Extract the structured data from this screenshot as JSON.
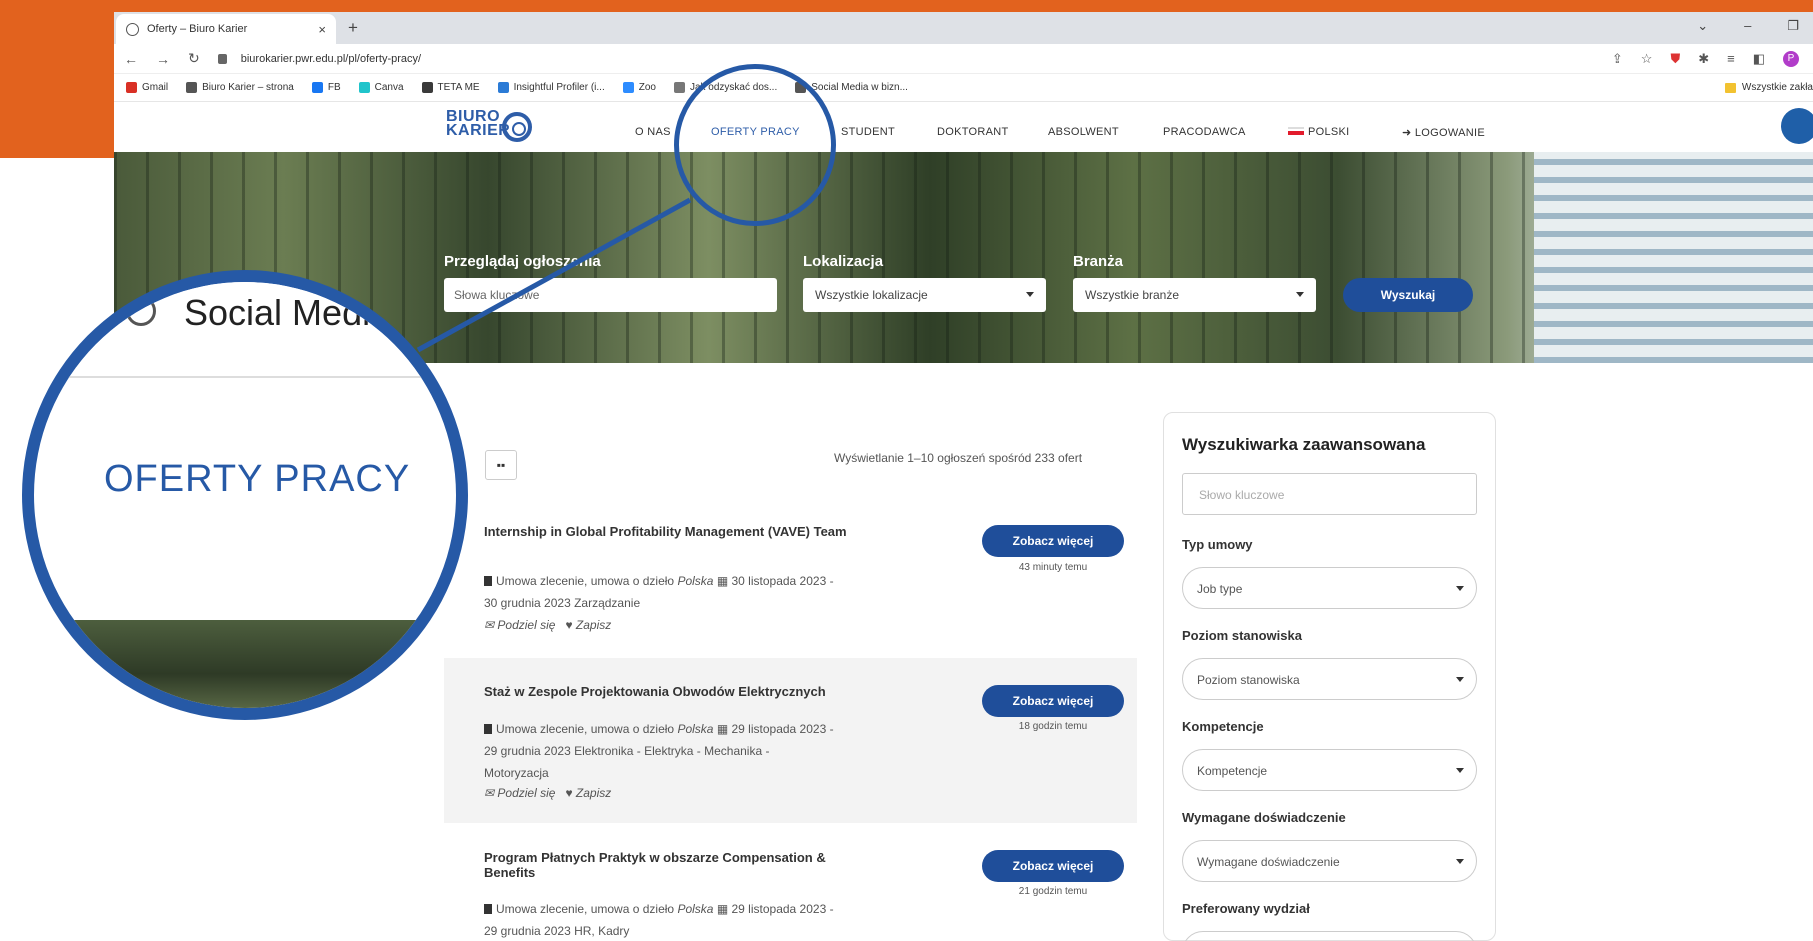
{
  "browser": {
    "tab_title": "Oferty – Biuro Karier",
    "tab_close": "×",
    "new_tab": "+",
    "url": "biurokarier.pwr.edu.pl/pl/oferty-pracy/",
    "bookmarks": [
      {
        "label": "Gmail",
        "icon_color": "#d93025"
      },
      {
        "label": "Biuro Karier – strona",
        "icon_color": "#555555"
      },
      {
        "label": "FB",
        "icon_color": "#1877f2"
      },
      {
        "label": "Canva",
        "icon_color": "#20c4cb"
      },
      {
        "label": "TETA ME",
        "icon_color": "#3a3a3a"
      },
      {
        "label": "Insightful Profiler (i...",
        "icon_color": "#2b7bd6"
      },
      {
        "label": "Zoo",
        "icon_color": "#2d8cff"
      },
      {
        "label": "Jak odzyskać dos...",
        "icon_color": "#777777"
      },
      {
        "label": "Social Media w bizn...",
        "icon_color": "#555555"
      }
    ],
    "bookmarks_other": "Wszystkie zakła"
  },
  "site": {
    "logo_line1": "BIURO",
    "logo_line2": "KARIER",
    "nav": [
      {
        "label": "O NAS",
        "active": false
      },
      {
        "label": "OFERTY PRACY",
        "active": true
      },
      {
        "label": "STUDENT",
        "active": false
      },
      {
        "label": "DOKTORANT",
        "active": false
      },
      {
        "label": "ABSOLWENT",
        "active": false
      },
      {
        "label": "PRACODAWCA",
        "active": false
      },
      {
        "label": "POLSKI",
        "active": false
      },
      {
        "label": "LOGOWANIE",
        "active": false
      }
    ]
  },
  "hero": {
    "browse_label": "Przeglądaj ogłoszenia",
    "keywords_placeholder": "Słowa kluczowe",
    "location_label": "Lokalizacja",
    "location_value": "Wszystkie lokalizacje",
    "industry_label": "Branża",
    "industry_value": "Wszystkie branże",
    "search_button": "Wyszukaj"
  },
  "listing": {
    "grid_icon": "grid-icon",
    "count_text": "Wyświetlanie 1–10 ogłoszeń spośród 233 ofert",
    "share_label": "Podziel się",
    "save_label": "Zapisz",
    "button_label": "Zobacz więcej",
    "jobs": [
      {
        "title": "Internship in Global Profitability Management (VAVE) Team",
        "contract": "Umowa zlecenie, umowa o dzieło",
        "country": "Polska",
        "dates_line1": "30 listopada 2023 -",
        "dates_line2": "30 grudnia 2023  Zarządzanie",
        "dates_line3": "",
        "posted": "43 minuty temu"
      },
      {
        "title": "Staż w Zespole Projektowania Obwodów Elektrycznych",
        "contract": "Umowa zlecenie, umowa o dzieło",
        "country": "Polska",
        "dates_line1": "29 listopada 2023 -",
        "dates_line2": "29 grudnia 2023  Elektronika - Elektryka - Mechanika -",
        "dates_line3": "Motoryzacja",
        "posted": "18 godzin temu"
      },
      {
        "title": "Program Płatnych Praktyk w obszarze Compensation & Benefits",
        "contract": "Umowa zlecenie, umowa o dzieło",
        "country": "Polska",
        "dates_line1": "29 listopada 2023 -",
        "dates_line2": "29 grudnia 2023  HR, Kadry",
        "dates_line3": "",
        "posted": "21 godzin temu"
      }
    ]
  },
  "advanced_search": {
    "title": "Wyszukiwarka zaawansowana",
    "keyword_placeholder": "Słowo kluczowe",
    "filters": [
      {
        "label": "Typ umowy",
        "value": "Job type"
      },
      {
        "label": "Poziom stanowiska",
        "value": "Poziom stanowiska"
      },
      {
        "label": "Kompetencje",
        "value": "Kompetencje"
      },
      {
        "label": "Wymagane doświadczenie",
        "value": "Wymagane doświadczenie"
      },
      {
        "label": "Preferowany wydział",
        "value": ""
      }
    ]
  },
  "magnifier": {
    "social_text": "Social Medi",
    "highlight_text": "OFERTY PRACY"
  },
  "colors": {
    "accent": "#2659a6",
    "button": "#1f4e9a",
    "orange": "#e2621e"
  }
}
